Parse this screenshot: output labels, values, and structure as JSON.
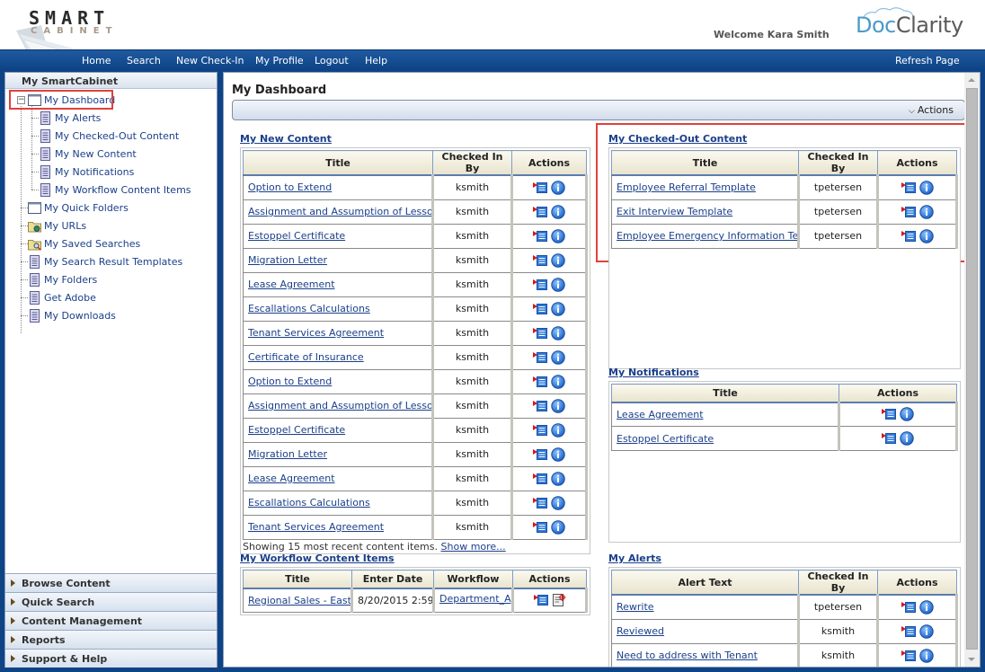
{
  "header": {
    "logo_primary": "SMART",
    "logo_secondary": "CABINET",
    "welcome": "Welcome Kara Smith",
    "brand_doc": "Doc",
    "brand_clarity": "Clarity"
  },
  "nav": {
    "items": [
      "Home",
      "Search",
      "New Check-In",
      "My Profile",
      "Logout",
      "Help"
    ],
    "refresh": "Refresh Page"
  },
  "sidebar": {
    "title": "My SmartCabinet",
    "tree": [
      {
        "label": "My Dashboard",
        "icon": "window-icon",
        "level": 0,
        "selected": true
      },
      {
        "label": "My Alerts",
        "icon": "document-icon",
        "level": 1
      },
      {
        "label": "My Checked-Out Content",
        "icon": "document-icon",
        "level": 1
      },
      {
        "label": "My New Content",
        "icon": "document-icon",
        "level": 1
      },
      {
        "label": "My Notifications",
        "icon": "document-icon",
        "level": 1
      },
      {
        "label": "My Workflow Content Items",
        "icon": "document-icon",
        "level": 1
      },
      {
        "label": "My Quick Folders",
        "icon": "window-icon",
        "level": 0
      },
      {
        "label": "My URLs",
        "icon": "folder-globe-icon",
        "level": 0
      },
      {
        "label": "My Saved Searches",
        "icon": "folder-search-icon",
        "level": 0
      },
      {
        "label": "My Search Result Templates",
        "icon": "document-icon",
        "level": 0
      },
      {
        "label": "My Folders",
        "icon": "document-icon",
        "level": 0
      },
      {
        "label": "Get Adobe",
        "icon": "document-icon",
        "level": 0
      },
      {
        "label": "My Downloads",
        "icon": "document-icon",
        "level": 0
      }
    ],
    "sections": [
      "Browse Content",
      "Quick Search",
      "Content Management",
      "Reports",
      "Support & Help"
    ]
  },
  "main": {
    "title": "My Dashboard",
    "actions_label": "Actions",
    "new_content": {
      "title": "My New Content",
      "columns": [
        "Title",
        "Checked In By",
        "Actions"
      ],
      "rows": [
        {
          "title": "Option to Extend",
          "by": "ksmith"
        },
        {
          "title": "Assignment and Assumption of Lessors Interest",
          "by": "ksmith"
        },
        {
          "title": "Estoppel Certificate",
          "by": "ksmith"
        },
        {
          "title": "Migration Letter",
          "by": "ksmith"
        },
        {
          "title": "Lease Agreement",
          "by": "ksmith"
        },
        {
          "title": "Escallations Calculations",
          "by": "ksmith"
        },
        {
          "title": "Tenant Services Agreement",
          "by": "ksmith"
        },
        {
          "title": "Certificate of Insurance",
          "by": "ksmith"
        },
        {
          "title": "Option to Extend",
          "by": "ksmith"
        },
        {
          "title": "Assignment and Assumption of Lessors Interest",
          "by": "ksmith"
        },
        {
          "title": "Estoppel Certificate",
          "by": "ksmith"
        },
        {
          "title": "Migration Letter",
          "by": "ksmith"
        },
        {
          "title": "Lease Agreement",
          "by": "ksmith"
        },
        {
          "title": "Escallations Calculations",
          "by": "ksmith"
        },
        {
          "title": "Tenant Services Agreement",
          "by": "ksmith"
        }
      ],
      "footer_text": "Showing 15 most recent content items.",
      "footer_link": "Show more..."
    },
    "checked_out": {
      "title": "My Checked-Out Content",
      "columns": [
        "Title",
        "Checked In By",
        "Actions"
      ],
      "rows": [
        {
          "title": "Employee Referral Template",
          "by": "tpetersen"
        },
        {
          "title": "Exit Interview Template",
          "by": "tpetersen"
        },
        {
          "title": "Employee Emergency Information Template",
          "by": "tpetersen"
        }
      ]
    },
    "notifications": {
      "title": "My Notifications",
      "columns": [
        "Title",
        "Actions"
      ],
      "rows": [
        {
          "title": "Lease Agreement"
        },
        {
          "title": "Estoppel Certificate"
        }
      ]
    },
    "workflow": {
      "title": "My Workflow Content Items",
      "columns": [
        "Title",
        "Enter Date",
        "Workflow",
        "Actions"
      ],
      "rows": [
        {
          "title": "Regional Sales - East",
          "date": "8/20/2015 2:59",
          "workflow": "Department_Approval"
        }
      ]
    },
    "alerts": {
      "title": "My Alerts",
      "columns": [
        "Alert Text",
        "Checked In By",
        "Actions"
      ],
      "rows": [
        {
          "title": "Rewrite",
          "by": "tpetersen"
        },
        {
          "title": "Reviewed",
          "by": "ksmith"
        },
        {
          "title": "Need to address with Tenant",
          "by": "ksmith"
        }
      ]
    }
  },
  "colors": {
    "nav_blue": "#0e4386",
    "link": "#1a3f8a",
    "highlight": "#e0413b"
  }
}
